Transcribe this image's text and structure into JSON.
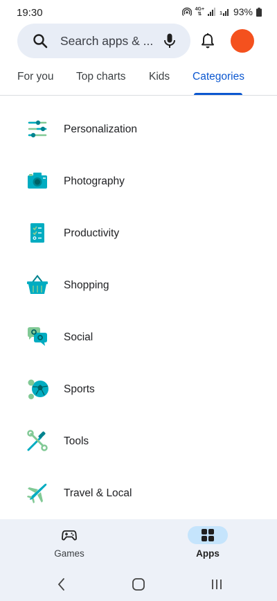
{
  "status_bar": {
    "time": "19:30",
    "network_top": "4G+",
    "network_bottom": "1",
    "battery": "93%"
  },
  "search": {
    "placeholder": "Search apps & ..."
  },
  "tabs": [
    {
      "label": "For you"
    },
    {
      "label": "Top charts"
    },
    {
      "label": "Kids"
    },
    {
      "label": "Categories"
    }
  ],
  "active_tab": "Categories",
  "categories": [
    {
      "label": "Personalization",
      "icon": "sliders-icon"
    },
    {
      "label": "Photography",
      "icon": "camera-icon"
    },
    {
      "label": "Productivity",
      "icon": "checklist-icon"
    },
    {
      "label": "Shopping",
      "icon": "basket-icon"
    },
    {
      "label": "Social",
      "icon": "chat-bubbles-icon"
    },
    {
      "label": "Sports",
      "icon": "sports-balls-icon"
    },
    {
      "label": "Tools",
      "icon": "screwdriver-wrench-icon"
    },
    {
      "label": "Travel & Local",
      "icon": "airplane-icon"
    }
  ],
  "bottom_nav": {
    "games": "Games",
    "apps": "Apps",
    "active": "Apps"
  },
  "colors": {
    "accent_blue": "#0b57d0",
    "teal": "#00acc1",
    "green": "#81c995",
    "avatar_orange": "#f4511e",
    "search_bg": "#e8edf6",
    "nav_bg": "#edf1f8",
    "nav_active_pill": "#c5e4fc"
  }
}
